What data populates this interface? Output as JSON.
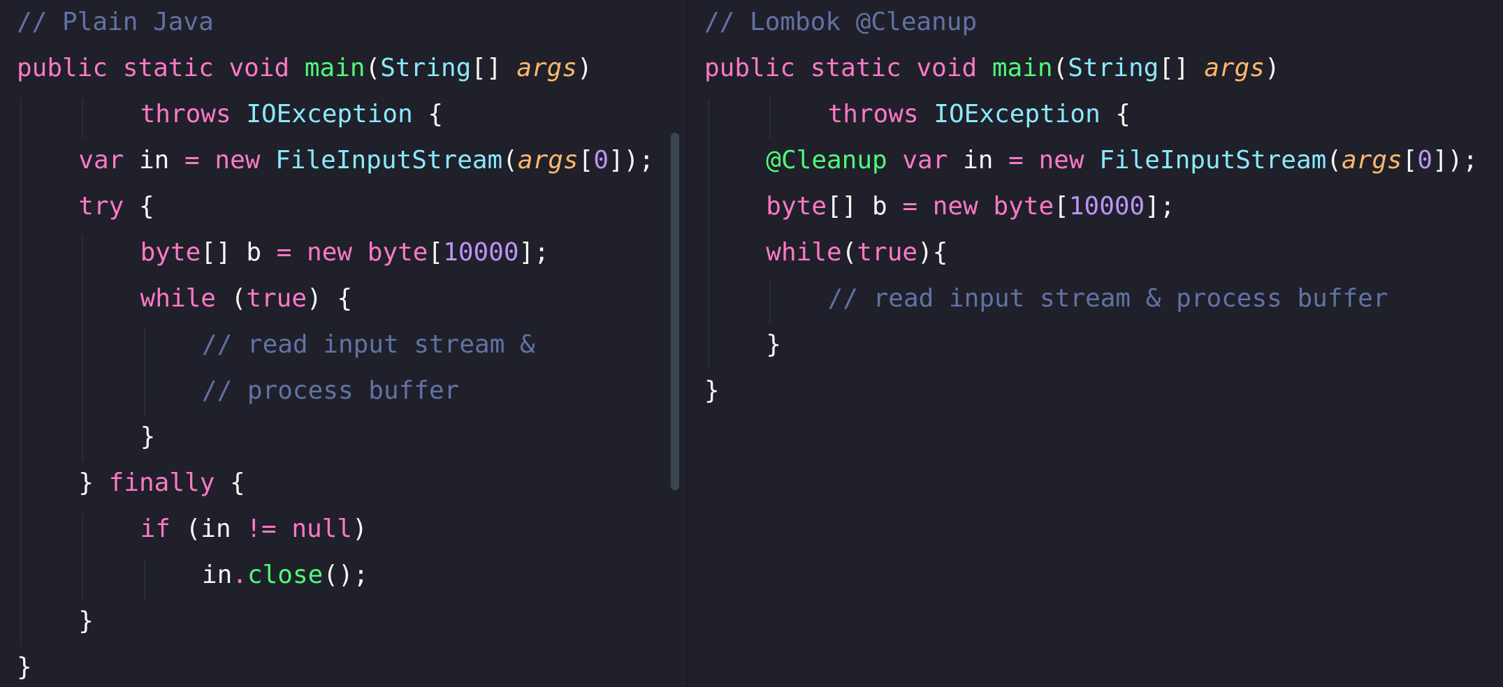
{
  "theme": {
    "background": "#1f202a",
    "comment": "#6272a4",
    "keyword": "#ff79c6",
    "function": "#50fa7b",
    "type": "#8be9fd",
    "param": "#ffb86c",
    "number": "#bd93f9",
    "text": "#f8f8f2"
  },
  "panes": {
    "left": {
      "title": "// Plain Java",
      "lines": [
        {
          "indent": 0,
          "tokens": [
            [
              "c",
              "// Plain Java"
            ]
          ]
        },
        {
          "indent": 0,
          "tokens": [
            [
              "k",
              "public"
            ],
            [
              "w",
              " "
            ],
            [
              "k",
              "static"
            ],
            [
              "w",
              " "
            ],
            [
              "k",
              "void"
            ],
            [
              "w",
              " "
            ],
            [
              "f",
              "main"
            ],
            [
              "w",
              "("
            ],
            [
              "t",
              "String"
            ],
            [
              "w",
              "[] "
            ],
            [
              "p",
              "args"
            ],
            [
              "w",
              ")"
            ]
          ]
        },
        {
          "indent": 2,
          "tokens": [
            [
              "k",
              "throws"
            ],
            [
              "w",
              " "
            ],
            [
              "t",
              "IOException"
            ],
            [
              "w",
              " {"
            ]
          ]
        },
        {
          "indent": 1,
          "tokens": [
            [
              "k",
              "var"
            ],
            [
              "w",
              " in "
            ],
            [
              "k",
              "="
            ],
            [
              "w",
              " "
            ],
            [
              "k",
              "new"
            ],
            [
              "w",
              " "
            ],
            [
              "t",
              "FileInputStream"
            ],
            [
              "w",
              "("
            ],
            [
              "p",
              "args"
            ],
            [
              "w",
              "["
            ],
            [
              "n",
              "0"
            ],
            [
              "w",
              "]);"
            ]
          ]
        },
        {
          "indent": 1,
          "tokens": [
            [
              "k",
              "try"
            ],
            [
              "w",
              " {"
            ]
          ]
        },
        {
          "indent": 2,
          "tokens": [
            [
              "k",
              "byte"
            ],
            [
              "w",
              "[] b "
            ],
            [
              "k",
              "="
            ],
            [
              "w",
              " "
            ],
            [
              "k",
              "new"
            ],
            [
              "w",
              " "
            ],
            [
              "k",
              "byte"
            ],
            [
              "w",
              "["
            ],
            [
              "n",
              "10000"
            ],
            [
              "w",
              "];"
            ]
          ]
        },
        {
          "indent": 2,
          "tokens": [
            [
              "k",
              "while"
            ],
            [
              "w",
              " ("
            ],
            [
              "k",
              "true"
            ],
            [
              "w",
              ") {"
            ]
          ]
        },
        {
          "indent": 3,
          "tokens": [
            [
              "c",
              "// read input stream &"
            ]
          ]
        },
        {
          "indent": 3,
          "tokens": [
            [
              "c",
              "// process buffer"
            ]
          ]
        },
        {
          "indent": 2,
          "tokens": [
            [
              "w",
              "}"
            ]
          ]
        },
        {
          "indent": 1,
          "tokens": [
            [
              "w",
              "} "
            ],
            [
              "k",
              "finally"
            ],
            [
              "w",
              " {"
            ]
          ]
        },
        {
          "indent": 2,
          "tokens": [
            [
              "k",
              "if"
            ],
            [
              "w",
              " (in "
            ],
            [
              "k",
              "!="
            ],
            [
              "w",
              " "
            ],
            [
              "k",
              "null"
            ],
            [
              "w",
              ")"
            ]
          ]
        },
        {
          "indent": 3,
          "tokens": [
            [
              "w",
              "in"
            ],
            [
              "k",
              "."
            ],
            [
              "f",
              "close"
            ],
            [
              "w",
              "();"
            ]
          ]
        },
        {
          "indent": 1,
          "tokens": [
            [
              "w",
              "}"
            ]
          ]
        },
        {
          "indent": 0,
          "tokens": [
            [
              "w",
              "}"
            ]
          ]
        }
      ]
    },
    "right": {
      "title": "// Lombok @Cleanup",
      "lines": [
        {
          "indent": 0,
          "tokens": [
            [
              "c",
              "// Lombok @Cleanup"
            ]
          ]
        },
        {
          "indent": 0,
          "tokens": [
            [
              "k",
              "public"
            ],
            [
              "w",
              " "
            ],
            [
              "k",
              "static"
            ],
            [
              "w",
              " "
            ],
            [
              "k",
              "void"
            ],
            [
              "w",
              " "
            ],
            [
              "f",
              "main"
            ],
            [
              "w",
              "("
            ],
            [
              "t",
              "String"
            ],
            [
              "w",
              "[] "
            ],
            [
              "p",
              "args"
            ],
            [
              "w",
              ")"
            ]
          ]
        },
        {
          "indent": 2,
          "tokens": [
            [
              "k",
              "throws"
            ],
            [
              "w",
              " "
            ],
            [
              "t",
              "IOException"
            ],
            [
              "w",
              " {"
            ]
          ]
        },
        {
          "indent": 1,
          "tokens": [
            [
              "a",
              "@Cleanup"
            ],
            [
              "w",
              " "
            ],
            [
              "k",
              "var"
            ],
            [
              "w",
              " in "
            ],
            [
              "k",
              "="
            ],
            [
              "w",
              " "
            ],
            [
              "k",
              "new"
            ],
            [
              "w",
              " "
            ],
            [
              "t",
              "FileInputStream"
            ],
            [
              "w",
              "("
            ],
            [
              "p",
              "args"
            ],
            [
              "w",
              "["
            ],
            [
              "n",
              "0"
            ],
            [
              "w",
              "]);"
            ]
          ]
        },
        {
          "indent": 1,
          "tokens": [
            [
              "k",
              "byte"
            ],
            [
              "w",
              "[] b "
            ],
            [
              "k",
              "="
            ],
            [
              "w",
              " "
            ],
            [
              "k",
              "new"
            ],
            [
              "w",
              " "
            ],
            [
              "k",
              "byte"
            ],
            [
              "w",
              "["
            ],
            [
              "n",
              "10000"
            ],
            [
              "w",
              "];"
            ]
          ]
        },
        {
          "indent": 1,
          "tokens": [
            [
              "k",
              "while"
            ],
            [
              "w",
              "("
            ],
            [
              "k",
              "true"
            ],
            [
              "w",
              "){"
            ]
          ]
        },
        {
          "indent": 2,
          "tokens": [
            [
              "c",
              "// read input stream & process buffer"
            ]
          ]
        },
        {
          "indent": 1,
          "tokens": [
            [
              "w",
              "}"
            ]
          ]
        },
        {
          "indent": 0,
          "tokens": [
            [
              "w",
              "}"
            ]
          ]
        }
      ]
    }
  }
}
